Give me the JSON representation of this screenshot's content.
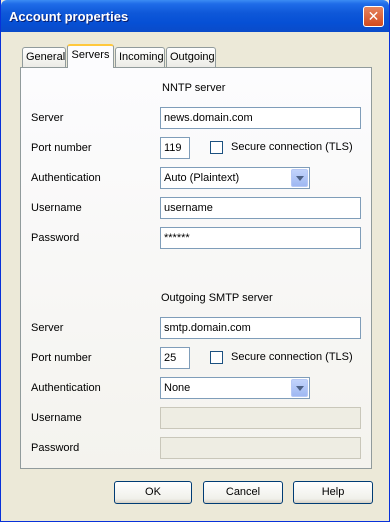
{
  "window": {
    "title": "Account properties",
    "close_glyph": "✕"
  },
  "tabs": [
    {
      "label": "General"
    },
    {
      "label": "Servers"
    },
    {
      "label": "Incoming"
    },
    {
      "label": "Outgoing"
    }
  ],
  "nntp": {
    "heading": "NNTP server",
    "server_label": "Server",
    "server_value": "news.domain.com",
    "port_label": "Port number",
    "port_value": "119",
    "secure_label": "Secure connection (TLS)",
    "secure_checked": false,
    "auth_label": "Authentication",
    "auth_value": "Auto (Plaintext)",
    "username_label": "Username",
    "username_value": "username",
    "password_label": "Password",
    "password_value": "******"
  },
  "smtp": {
    "heading": "Outgoing SMTP server",
    "server_label": "Server",
    "server_value": "smtp.domain.com",
    "port_label": "Port number",
    "port_value": "25",
    "secure_label": "Secure connection (TLS)",
    "secure_checked": false,
    "auth_label": "Authentication",
    "auth_value": "None",
    "username_label": "Username",
    "username_value": "",
    "password_label": "Password",
    "password_value": ""
  },
  "buttons": {
    "ok": "OK",
    "cancel": "Cancel",
    "help": "Help"
  },
  "colors": {
    "titlebar": "#0650D5",
    "window_bg": "#ECE9D8",
    "active_tab_accent": "#FFC83C"
  }
}
